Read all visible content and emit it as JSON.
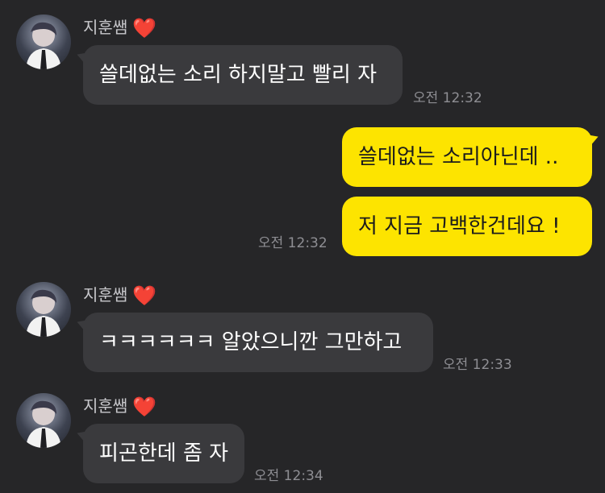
{
  "messages": [
    {
      "sender": "지훈쌤",
      "sender_heart": "❤️",
      "text": "쓸데없는 소리 하지말고 빨리 자",
      "time": "오전 12:32"
    },
    {
      "text": "쓸데없는 소리아닌데 .."
    },
    {
      "text": "저 지금 고백한건데요 !",
      "time": "오전 12:32"
    },
    {
      "sender": "지훈쌤",
      "sender_heart": "❤️",
      "text": "ㅋㅋㅋㅋㅋㅋ 알았으니깐 그만하고",
      "time": "오전 12:33"
    },
    {
      "sender": "지훈쌤",
      "sender_heart": "❤️",
      "text": "피곤한데 좀 자",
      "time": "오전 12:34"
    }
  ],
  "colors": {
    "background": "#262628",
    "incoming_bubble": "#3a3a3d",
    "outgoing_bubble": "#fde400",
    "heart": "#e0202f"
  }
}
